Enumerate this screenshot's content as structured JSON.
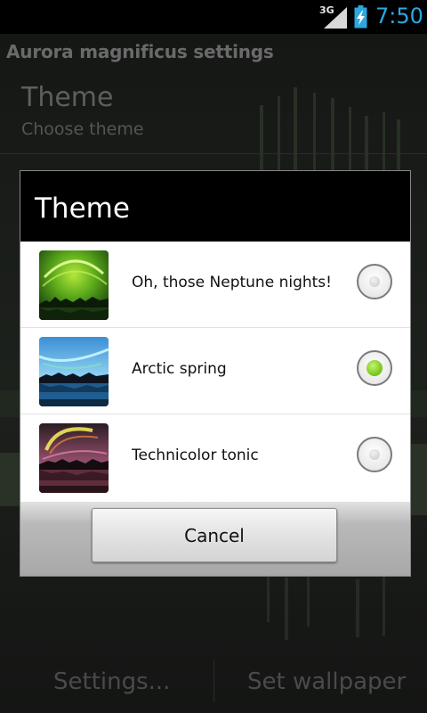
{
  "status_bar": {
    "network": "3G",
    "time": "7:50",
    "time_color": "#2ea7e0"
  },
  "settings_screen": {
    "app_title": "Aurora magnificus settings",
    "preference": {
      "title": "Theme",
      "summary": "Choose theme"
    },
    "buttons": {
      "settings": "Settings...",
      "set_wallpaper": "Set wallpaper"
    }
  },
  "dialog": {
    "title": "Theme",
    "options": [
      {
        "label": "Oh, those Neptune nights!",
        "selected": false,
        "thumbnail": "green-aurora-thumbnail"
      },
      {
        "label": "Arctic spring",
        "selected": true,
        "thumbnail": "blue-aurora-thumbnail"
      },
      {
        "label": "Technicolor tonic",
        "selected": false,
        "thumbnail": "multicolor-aurora-thumbnail"
      }
    ],
    "cancel_label": "Cancel"
  },
  "colors": {
    "radio_selected": "#7cc41e",
    "dialog_title_bg": "#000000"
  }
}
